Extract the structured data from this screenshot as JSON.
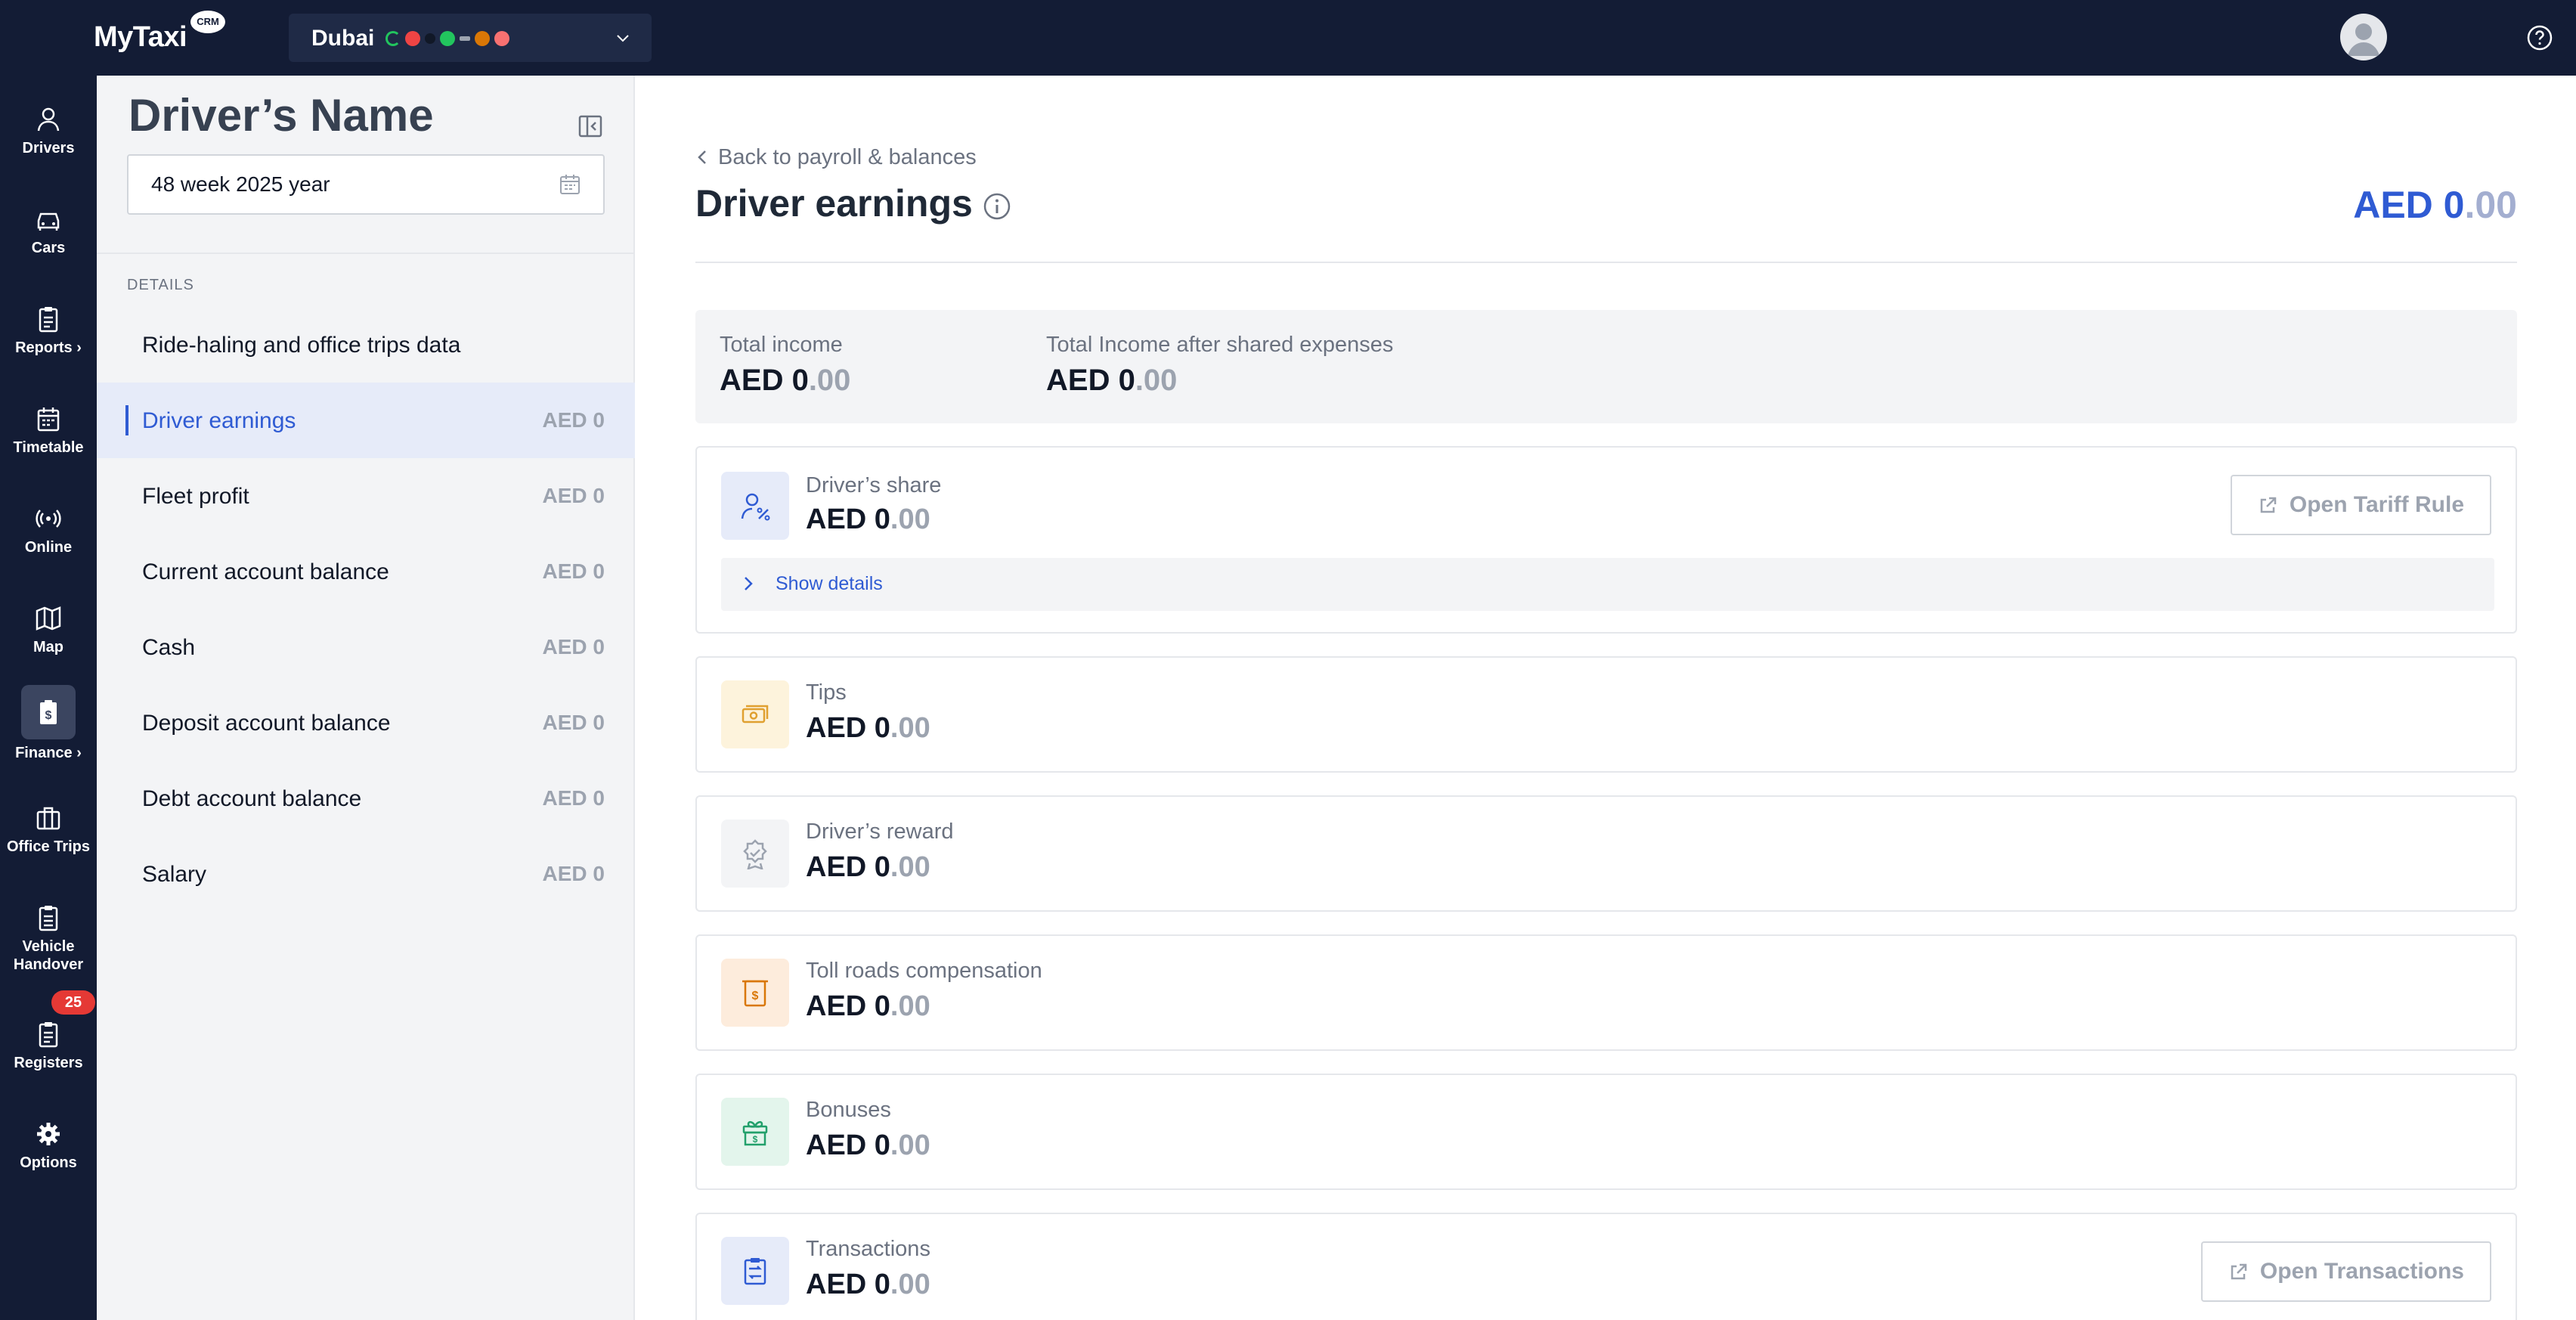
{
  "header": {
    "logo": "MyTaxi",
    "logo_badge": "CRM",
    "city": "Dubai"
  },
  "sidebar": {
    "items": [
      {
        "label": "Drivers",
        "icon": "user-icon"
      },
      {
        "label": "Cars",
        "icon": "car-icon"
      },
      {
        "label": "Reports",
        "icon": "clipboard-icon",
        "has_chevron": true
      },
      {
        "label": "Timetable",
        "icon": "calendar-icon"
      },
      {
        "label": "Online",
        "icon": "broadcast-icon"
      },
      {
        "label": "Map",
        "icon": "map-icon"
      },
      {
        "label": "Finance",
        "icon": "finance-icon",
        "has_chevron": true,
        "active": true
      },
      {
        "label": "Office Trips",
        "icon": "briefcase-icon"
      },
      {
        "label": "Vehicle Handover",
        "icon": "handover-icon"
      },
      {
        "label": "Registers",
        "icon": "register-icon",
        "badge": "25"
      },
      {
        "label": "Options",
        "icon": "gear-icon"
      }
    ],
    "label_reports": "Reports ›",
    "label_finance": "Finance ›",
    "label_vehicle_1": "Vehicle",
    "label_vehicle_2": "Handover",
    "registers_badge": "25"
  },
  "panel": {
    "driver_name": "Driver’s Name",
    "week": "48 week 2025 year",
    "details_label": "DETAILS",
    "items": [
      {
        "label": "Ride-haling and office trips data",
        "value": ""
      },
      {
        "label": "Driver earnings",
        "value": "AED 0",
        "active": true
      },
      {
        "label": "Fleet profit",
        "value": "AED 0"
      },
      {
        "label": "Current account balance",
        "value": "AED 0"
      },
      {
        "label": "Cash",
        "value": "AED 0"
      },
      {
        "label": "Deposit account balance",
        "value": "AED 0"
      },
      {
        "label": "Debt account balance",
        "value": "AED 0"
      },
      {
        "label": "Salary",
        "value": "AED 0"
      }
    ]
  },
  "main": {
    "back_link": "Back to payroll & balances",
    "title": "Driver earnings",
    "total_main": "AED 0",
    "total_dec": ".00",
    "summary": {
      "total_income_label": "Total income",
      "total_income_main": "AED 0",
      "total_income_dec": ".00",
      "after_shared_label": "Total Income after shared expenses",
      "after_shared_main": "AED 0",
      "after_shared_dec": ".00"
    },
    "cards": [
      {
        "label": "Driver’s share",
        "main": "AED 0",
        "dec": ".00",
        "icon": "user-percent-icon",
        "button": "Open Tariff Rule",
        "details": "Show details"
      },
      {
        "label": "Tips",
        "main": "AED 0",
        "dec": ".00",
        "icon": "cash-icon"
      },
      {
        "label": "Driver’s reward",
        "main": "AED 0",
        "dec": ".00",
        "icon": "award-icon"
      },
      {
        "label": "Toll roads compensation",
        "main": "AED 0",
        "dec": ".00",
        "icon": "toll-receipt-icon"
      },
      {
        "label": "Bonuses",
        "main": "AED 0",
        "dec": ".00",
        "icon": "gift-icon"
      },
      {
        "label": "Transactions",
        "main": "AED 0",
        "dec": ".00",
        "icon": "transactions-icon",
        "button": "Open Transactions"
      }
    ]
  },
  "colors": {
    "topbar": "#131c35",
    "accent": "#2f5bd3",
    "active_bg": "#e6ebf9",
    "badge": "#e53935"
  }
}
